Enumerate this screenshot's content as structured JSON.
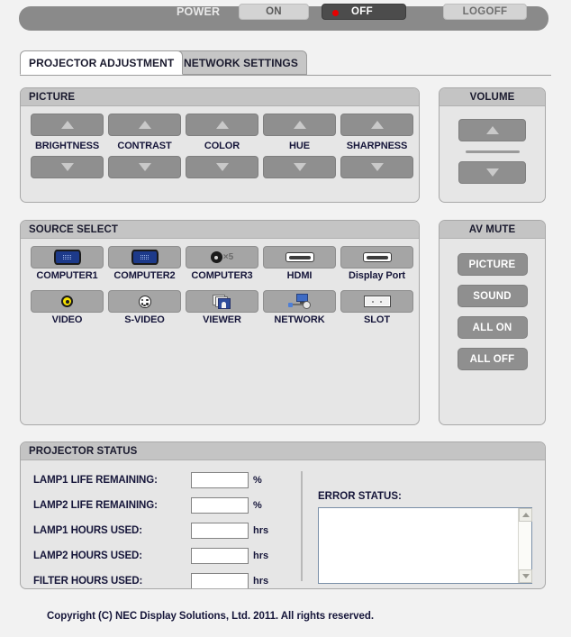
{
  "power_bar": {
    "label": "POWER",
    "on_label": "ON",
    "off_label": "OFF",
    "logoff_label": "LOGOFF",
    "active_state": "OFF",
    "led_color": "#e60000",
    "bar_color": "#8a8a8a"
  },
  "tabs": [
    {
      "label": "PROJECTOR ADJUSTMENT",
      "active": true
    },
    {
      "label": "NETWORK SETTINGS",
      "active": false
    }
  ],
  "picture": {
    "title": "PICTURE",
    "up_icon": "triangle-up-icon",
    "down_icon": "triangle-down-icon",
    "controls": [
      {
        "label": "BRIGHTNESS"
      },
      {
        "label": "CONTRAST"
      },
      {
        "label": "COLOR"
      },
      {
        "label": "HUE"
      },
      {
        "label": "SHARPNESS"
      }
    ]
  },
  "volume": {
    "title": "VOLUME",
    "up_icon": "triangle-up-icon",
    "down_icon": "triangle-down-icon"
  },
  "source_select": {
    "title": "SOURCE SELECT",
    "row1": [
      {
        "label": "COMPUTER1",
        "icon": "vga-connector-icon"
      },
      {
        "label": "COMPUTER2",
        "icon": "vga-connector-icon"
      },
      {
        "label": "COMPUTER3",
        "icon": "bnc-x5-connector-icon",
        "icon_text": "×5"
      },
      {
        "label": "HDMI",
        "icon": "hdmi-connector-icon"
      },
      {
        "label": "Display Port",
        "icon": "displayport-connector-icon"
      }
    ],
    "row2": [
      {
        "label": "VIDEO",
        "icon": "rca-video-jack-icon"
      },
      {
        "label": "S-VIDEO",
        "icon": "s-video-connector-icon"
      },
      {
        "label": "VIEWER",
        "icon": "viewer-slides-icon"
      },
      {
        "label": "NETWORK",
        "icon": "network-monitor-icon"
      },
      {
        "label": "SLOT",
        "icon": "slot-card-icon"
      }
    ]
  },
  "av_mute": {
    "title": "AV MUTE",
    "buttons": [
      {
        "label": "PICTURE"
      },
      {
        "label": "SOUND"
      },
      {
        "label": "ALL ON"
      },
      {
        "label": "ALL OFF"
      }
    ]
  },
  "projector_status": {
    "title": "PROJECTOR STATUS",
    "rows": [
      {
        "label": "LAMP1 LIFE REMAINING:",
        "value": "",
        "unit": "%"
      },
      {
        "label": "LAMP2 LIFE REMAINING:",
        "value": "",
        "unit": "%"
      },
      {
        "label": "LAMP1 HOURS USED:",
        "value": "",
        "unit": "hrs"
      },
      {
        "label": "LAMP2 HOURS USED:",
        "value": "",
        "unit": "hrs"
      },
      {
        "label": "FILTER HOURS USED:",
        "value": "",
        "unit": "hrs"
      }
    ],
    "error_status": {
      "label": "ERROR STATUS:",
      "value": "",
      "scroll_up_icon": "scroll-up-arrow-icon",
      "scroll_down_icon": "scroll-down-arrow-icon"
    }
  },
  "footer": {
    "copyright": "Copyright (C) NEC Display Solutions, Ltd. 2011. All rights reserved."
  }
}
